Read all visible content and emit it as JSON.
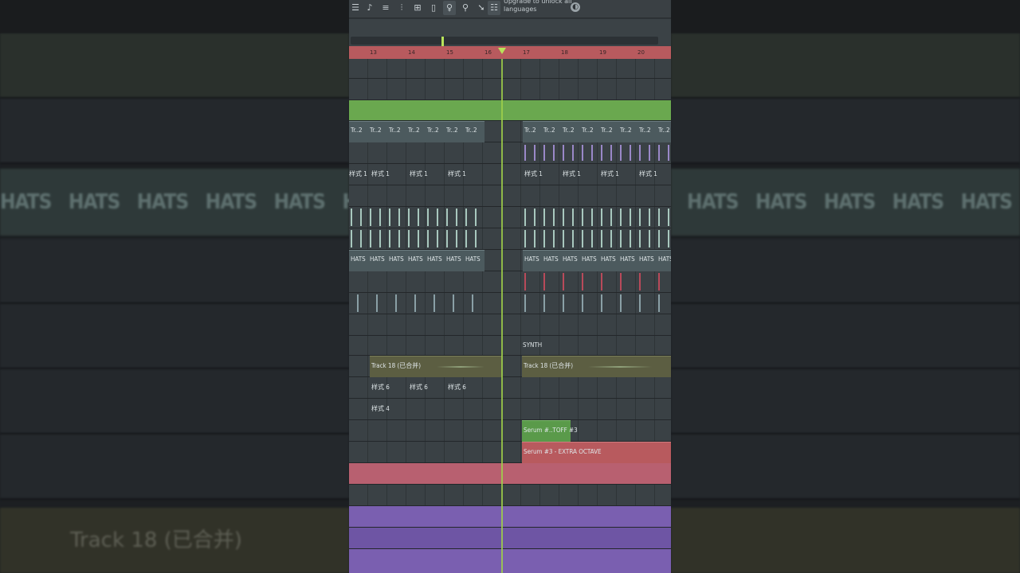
{
  "toolbar": {
    "upgrade_text": "Upgrade to unlock all languages",
    "buttons": [
      "playlist-icon",
      "piano-roll-icon",
      "channel-rack-icon",
      "mixer-icon",
      "plugin-icon",
      "browser-icon",
      "mic-icon",
      "tempo-icon",
      "export-icon",
      "menu-icon"
    ]
  },
  "ruler": {
    "bars": [
      "13",
      "14",
      "15",
      "16",
      "17",
      "18",
      "19",
      "20"
    ]
  },
  "clips": {
    "tr2": "Tr..2",
    "style1": "样式 1",
    "hats": "HATS",
    "synth": "SYNTH",
    "track18": "Track 18 (已合并)",
    "style6": "样式 6",
    "style4": "样式 4",
    "serum_toff": "Serum #..TOFF #3",
    "serum_extra": "Serum #3 - EXTRA OCTAVE"
  },
  "background": {
    "hats_label": "HATS",
    "track_label": "Track 18 (已合并)"
  },
  "colors": {
    "accent": "#9fd04a",
    "ruler": "#b85a5e",
    "green_lane": "#6aa84f",
    "track18": "#5c5e42",
    "serum_toff": "#5a9a4a",
    "serum_extra": "#b85a5e",
    "pink_lane": "#b86070",
    "purple_lane": "#7a5fb0"
  }
}
